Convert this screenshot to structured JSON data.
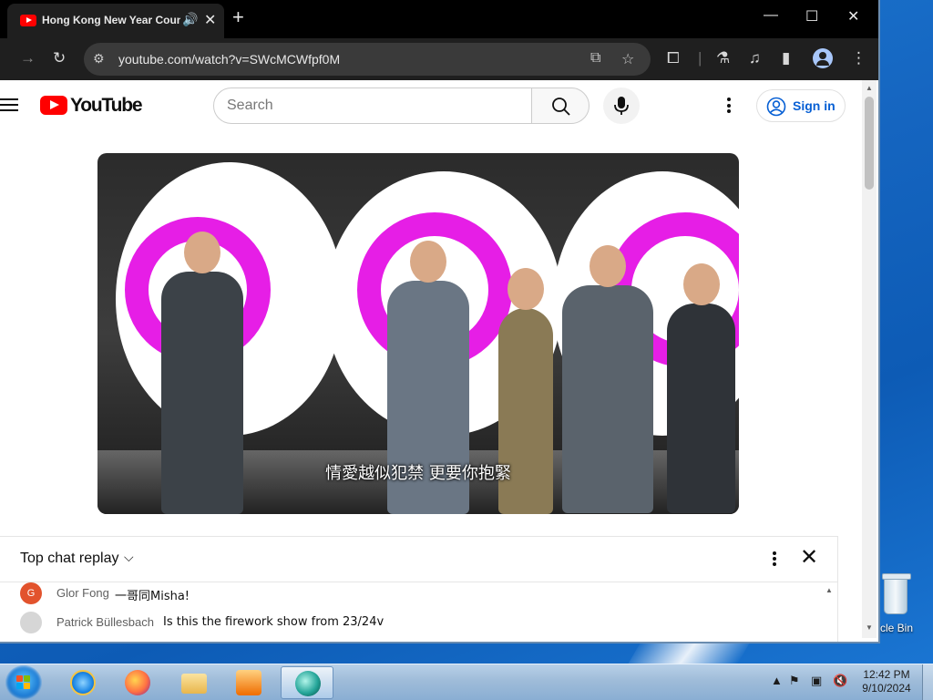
{
  "browser": {
    "tab_title": "Hong Kong New Year Countdown",
    "url": "youtube.com/watch?v=SWcMCWfpf0M",
    "new_tab_glyph": "+",
    "close_glyph": "✕"
  },
  "youtube": {
    "wordmark": "YouTube",
    "search_placeholder": "Search",
    "sign_in_label": "Sign in",
    "accent_color": "#ff0000",
    "link_color": "#065fd4"
  },
  "video": {
    "subtitle": "情愛越似犯禁 更要你抱緊"
  },
  "chat": {
    "title": "Top chat replay",
    "messages": [
      {
        "avatar": "G",
        "avatar_color": "#e2532d",
        "author": "Glor Fong",
        "text": "一哥同Misha!"
      },
      {
        "avatar": "",
        "avatar_color": "#c9c9c9",
        "author": "Patrick Büllesbach",
        "text": "Is this the firework show from 23/24v"
      }
    ]
  },
  "desktop": {
    "recycle_bin_label": "rcle Bin"
  },
  "taskbar": {
    "time": "12:42 PM",
    "date": "9/10/2024",
    "apps": [
      "internet-explorer",
      "firefox",
      "file-explorer",
      "media-player",
      "app-active"
    ]
  }
}
